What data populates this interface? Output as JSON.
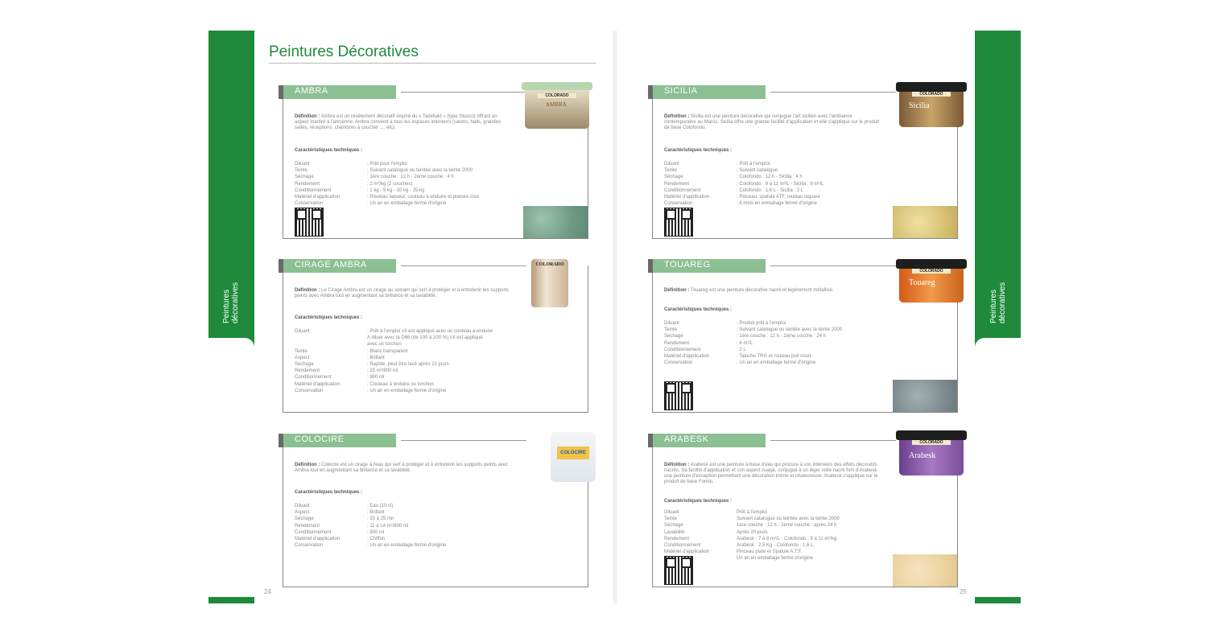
{
  "page": {
    "title": "Peintures Décoratives",
    "side_label_left": "Peintures décoratives",
    "side_label_right": "Peintures décoratives",
    "page_num_left": "24",
    "page_num_right": "25",
    "accent": "#1f8a3c"
  },
  "products": {
    "ambra": {
      "name": "AMBRA",
      "def_label": "Définition :",
      "definition": " Ambra est un revêtement décoratif inspiré du « Tadellakt » (type Stucco) offrant un aspect marbré à l'ancienne. Ambra convient à tous les espaces intérieurs (salons, halls, grandes salles, réceptions, chambres à coucher ..., etc).",
      "car_title": "Caractéristiques techniques :",
      "specs": [
        {
          "k": "Diluant",
          "v": ": Prêt pour l'emploi"
        },
        {
          "k": "Teinte",
          "v": ": Suivant catalogue ou teintée avec la teinte 2000"
        },
        {
          "k": "Séchage",
          "v": ": 1ère couche : 12 h - 2ème couche : 4 h"
        },
        {
          "k": "Rendement",
          "v": ": 2 m²/kg (2 couches)"
        },
        {
          "k": "Conditionnement",
          "v": ": 1 kg - 5 kg - 10 kg - 25 kg"
        },
        {
          "k": "Matériel d'application",
          "v": ": Rouleau laqueur, couteau à enduire et platoire inox"
        },
        {
          "k": "Conservation",
          "v": ": Un an en emballage fermé d'origine"
        }
      ],
      "brand": "COLORADO",
      "label": "AMBRA"
    },
    "cirage": {
      "name": "CIRAGE AMBRA",
      "def_label": "Définition :",
      "definition": " Le Cirage Ambra est un cirage au solvant qui sert à protéger et à entretenir les supports peints avec Ambra tout en augmentant sa brillance et sa lavabilité.",
      "car_title": "Caractéristiques techniques :",
      "specs": [
        {
          "k": "Diluant",
          "v": ": Prêt à l'emploi s'il est appliqué avec un couteau à enduire"
        },
        {
          "k": "",
          "v": "  A diluer avec le D66 (de 100 à 200 %) s'il est appliqué"
        },
        {
          "k": "",
          "v": "  avec un torchon"
        },
        {
          "k": "Teinte",
          "v": ": Blanc transparent"
        },
        {
          "k": "Aspect",
          "v": ": Brillant"
        },
        {
          "k": "Séchage",
          "v": ": Rapide, peut être lavé après 21 jours"
        },
        {
          "k": "Rendement",
          "v": ": 15 m²/800 ml"
        },
        {
          "k": "Conditionnement",
          "v": ": 800 ml"
        },
        {
          "k": "Matériel d'application",
          "v": ": Couteau à enduire ou torchon"
        },
        {
          "k": "Conservation",
          "v": ": Un an en emballage fermé d'origine"
        }
      ],
      "brand": "COLORADO"
    },
    "colocire": {
      "name": "COLOCIRE",
      "def_label": "Définition :",
      "definition": " Colocire est un cirage à l'eau qui sert à protéger et à entretenir les supports peints avec Ambra tout en augmentant sa brillance et sa lavabilité.",
      "car_title": "Caractéristiques techniques :",
      "specs": [
        {
          "k": "Diluant",
          "v": ": Eau (10 cl)"
        },
        {
          "k": "Aspect",
          "v": ": Brillant"
        },
        {
          "k": "Séchage",
          "v": ": 20 à 25 mn"
        },
        {
          "k": "Rendement",
          "v": ": 11 à 14 m²/800 ml"
        },
        {
          "k": "Conditionnement",
          "v": ": 800 ml"
        },
        {
          "k": "Matériel d'application",
          "v": ": Chiffon"
        },
        {
          "k": "Conservation",
          "v": ": Un an en emballage fermé d'origine"
        }
      ],
      "label": "COLOCIRE"
    },
    "sicilia": {
      "name": "SICILIA",
      "def_label": "Définition :",
      "definition": " Sicilia est une peinture décorative qui conjugue l'art sicilien avec l'ambiance contemporaine au Maroc. Sicilia offre une grande facilité d'application et elle s'applique sur le produit de base Colofondo.",
      "car_title": "Caractéristiques techniques :",
      "specs": [
        {
          "k": "Diluant",
          "v": ": Prêt à l'emploi"
        },
        {
          "k": "Teinte",
          "v": ": Suivant catalogue"
        },
        {
          "k": "Séchage",
          "v": ": Colofondo : 12 h - Sicilia : 4 h"
        },
        {
          "k": "Rendement",
          "v": ": Colofondo : 9 à 11 m²/L - Sicilia : 8 m²/L"
        },
        {
          "k": "Conditionnement",
          "v": ": Colofondo : 1,6 L - Sicilia : 2 L"
        },
        {
          "k": "Matériel d'application",
          "v": ": Pinceau, spatule ATF, rouleau laqueur"
        },
        {
          "k": "Conservation",
          "v": ": 6 mois en emballage fermé d'origine"
        }
      ],
      "brand": "COLORADO",
      "label": "Sicilia"
    },
    "touareg": {
      "name": "TOUAREG",
      "def_label": "Définition :",
      "definition": " Touareg est une peinture décorative nacré et légèrement métallisé.",
      "car_title": "Caractéristiques techniques :",
      "specs": [
        {
          "k": "Diluant",
          "v": ": Produit prêt à l'emploi"
        },
        {
          "k": "Teinte",
          "v": ": Suivant catalogue ou teintée avec la teinte 2000"
        },
        {
          "k": "Séchage",
          "v": ": 1ère couche : 12 h - 2ème couche : 24 h"
        },
        {
          "k": "Rendement",
          "v": ": 6 m²/L"
        },
        {
          "k": "Conditionnement",
          "v": ": 2 L"
        },
        {
          "k": "Matériel d'application",
          "v": ": Taloche TRG et rouleau poil court"
        },
        {
          "k": "Conservation",
          "v": ": Un an en emballage fermé d'origine"
        }
      ],
      "brand": "COLORADO",
      "label": "Touareg"
    },
    "arabesk": {
      "name": "ARABESK",
      "def_label": "Définition :",
      "definition": " Arabesk est une peinture à base d'eau qui procure à vos intérieurs des effets décoratifs nacrés. Sa facilité d'application et son aspect nuagé, conjugué à un léger voile nacré font d'Arabesk une peinture d'exception permettant une décoration intime et chaleureuse. Arabesk s'applique sur le produit de base Fondo.",
      "car_title": "Caractéristiques techniques :",
      "specs": [
        {
          "k": "Diluant",
          "v": "Prêt à l'emploi"
        },
        {
          "k": "Teinte",
          "v": "Suivant catalogue ou teintée avec la teinte 2000"
        },
        {
          "k": "Séchage",
          "v": "1ère couche : 12 h - 2ème couche : après 24 h"
        },
        {
          "k": "Lavabilité",
          "v": "Après 20 jours"
        },
        {
          "k": "Rendement",
          "v": "Arabesk : 7 à 8 m²/L - Colofondo : 9 à 11 m²/kg"
        },
        {
          "k": "Conditionnement",
          "v": "Arabesk : 2,5 Kg - Colofondo : 1,6 L"
        },
        {
          "k": "Matériel d'application",
          "v": "Pinceau plate et Spatule A.T.F."
        },
        {
          "k": "Conservation",
          "v": "Un an en emballage fermé d'origine"
        }
      ],
      "brand": "COLORADO",
      "label": "Arabesk"
    }
  }
}
